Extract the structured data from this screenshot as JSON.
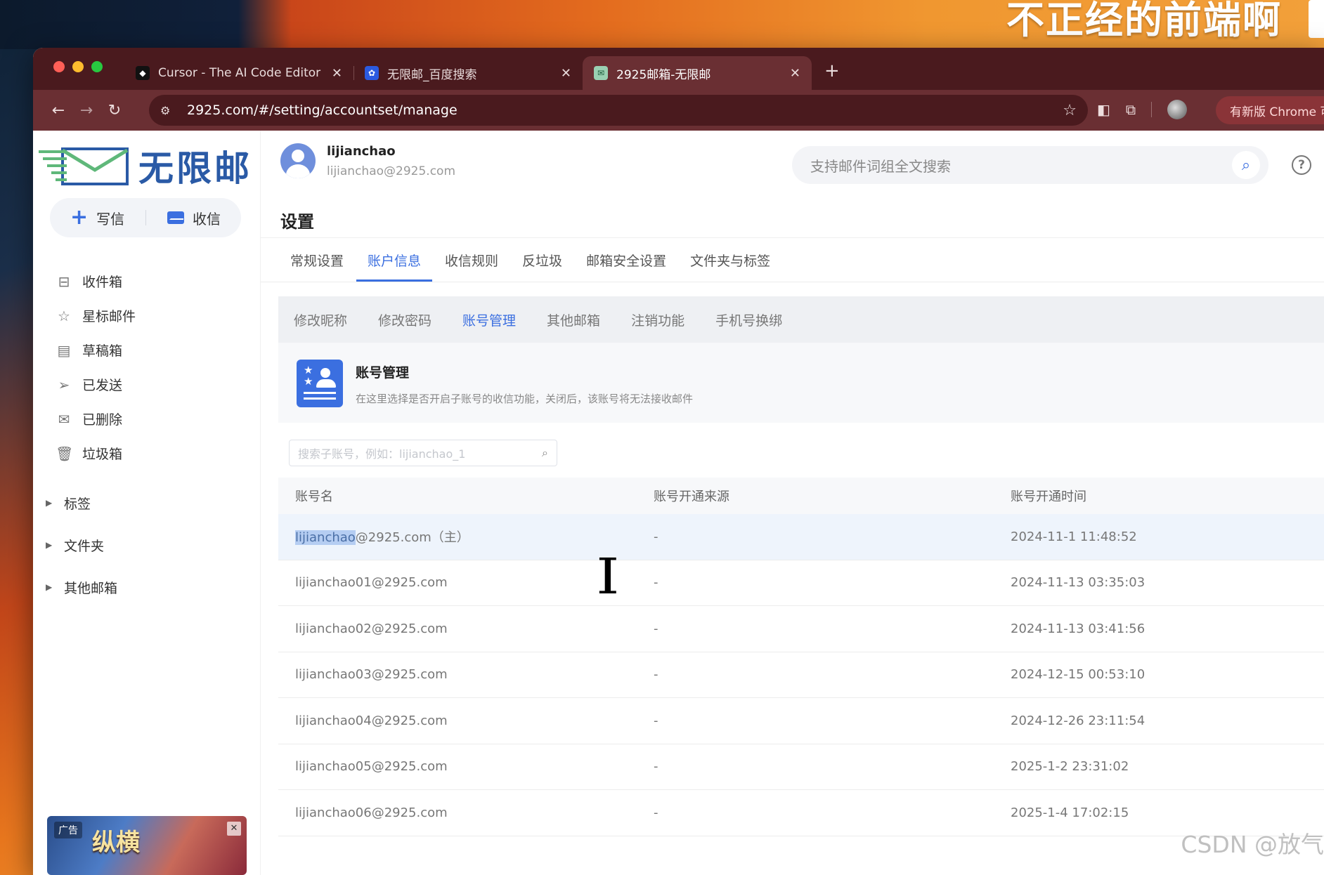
{
  "wallpaper": {
    "text": "不正经的前端啊"
  },
  "browser": {
    "tabs": [
      {
        "title": "Cursor - The AI Code Editor",
        "icon": "cursor-favicon"
      },
      {
        "title": "无限邮_百度搜索",
        "icon": "baidu-favicon"
      },
      {
        "title": "2925邮箱-无限邮",
        "icon": "mail-favicon"
      }
    ],
    "url": "2925.com/#/setting/accountset/manage",
    "update_label": "有新版 Chrome 可"
  },
  "app": {
    "logo_text": "无限邮",
    "compose_label": "写信",
    "receive_label": "收信",
    "nav": [
      {
        "label": "收件箱",
        "icon": "inbox-icon"
      },
      {
        "label": "星标邮件",
        "icon": "star-icon"
      },
      {
        "label": "草稿箱",
        "icon": "draft-icon"
      },
      {
        "label": "已发送",
        "icon": "send-icon"
      },
      {
        "label": "已删除",
        "icon": "deleted-icon"
      },
      {
        "label": "垃圾箱",
        "icon": "trash-icon"
      }
    ],
    "groups": [
      "标签",
      "文件夹",
      "其他邮箱"
    ],
    "ad": {
      "tag": "广告",
      "title": "纵横"
    },
    "user": {
      "name": "lijianchao",
      "email": "lijianchao@2925.com"
    },
    "search_placeholder": "支持邮件词组全文搜索",
    "page_title": "设置",
    "main_tabs": [
      "常规设置",
      "账户信息",
      "收信规则",
      "反垃圾",
      "邮箱安全设置",
      "文件夹与标签"
    ],
    "active_main_tab": "账户信息",
    "sub_tabs": [
      "修改昵称",
      "修改密码",
      "账号管理",
      "其他邮箱",
      "注销功能",
      "手机号换绑"
    ],
    "active_sub_tab": "账号管理",
    "section": {
      "title": "账号管理",
      "desc": "在这里选择是否开启子账号的收信功能，关闭后，该账号将无法接收邮件"
    },
    "sub_search_placeholder": "搜索子账号，例如：lijianchao_1",
    "table": {
      "columns": [
        "账号名",
        "账号开通来源",
        "账号开通时间"
      ],
      "rows": [
        {
          "sel": "lijianchao",
          "rest": "@2925.com（主）",
          "source": "-",
          "time": "2024-11-1 11:48:52"
        },
        {
          "name": "lijianchao01@2925.com",
          "source": "-",
          "time": "2024-11-13 03:35:03"
        },
        {
          "name": "lijianchao02@2925.com",
          "source": "-",
          "time": "2024-11-13 03:41:56"
        },
        {
          "name": "lijianchao03@2925.com",
          "source": "-",
          "time": "2024-12-15 00:53:10"
        },
        {
          "name": "lijianchao04@2925.com",
          "source": "-",
          "time": "2024-12-26 23:11:54"
        },
        {
          "name": "lijianchao05@2925.com",
          "source": "-",
          "time": "2025-1-2 23:31:02"
        },
        {
          "name": "lijianchao06@2925.com",
          "source": "-",
          "time": "2025-1-4 17:02:15"
        }
      ]
    }
  },
  "watermark": "CSDN @放气"
}
